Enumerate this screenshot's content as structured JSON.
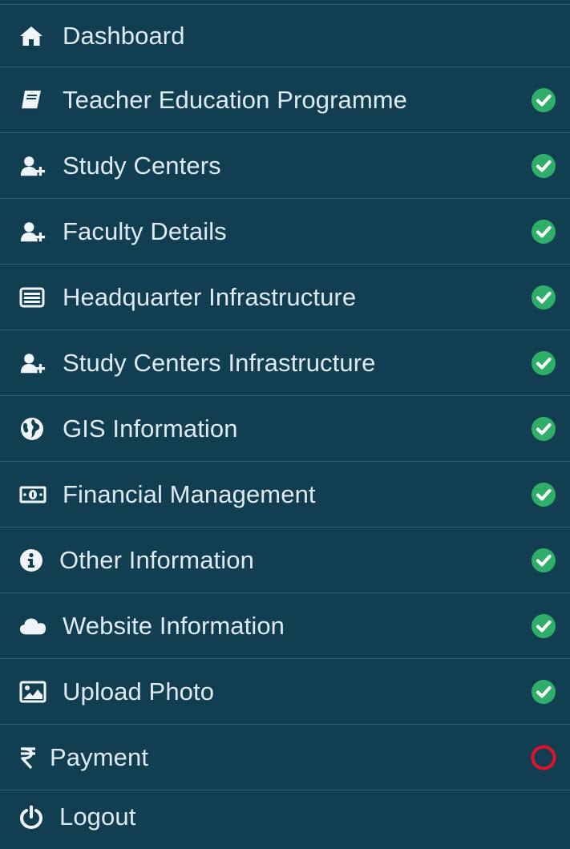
{
  "sidebar": {
    "items": [
      {
        "label": "Dashboard",
        "icon": "home-icon",
        "status": "none"
      },
      {
        "label": "Teacher Education Programme",
        "icon": "book-icon",
        "status": "complete"
      },
      {
        "label": "Study Centers",
        "icon": "user-plus-icon",
        "status": "complete"
      },
      {
        "label": "Faculty Details",
        "icon": "user-plus-icon",
        "status": "complete"
      },
      {
        "label": "Headquarter Infrastructure",
        "icon": "list-alt-icon",
        "status": "complete"
      },
      {
        "label": "Study Centers Infrastructure",
        "icon": "user-plus-icon",
        "status": "complete"
      },
      {
        "label": "GIS Information",
        "icon": "globe-icon",
        "status": "complete"
      },
      {
        "label": "Financial Management",
        "icon": "money-icon",
        "status": "complete"
      },
      {
        "label": "Other Information",
        "icon": "info-icon",
        "status": "complete"
      },
      {
        "label": "Website Information",
        "icon": "cloud-icon",
        "status": "complete"
      },
      {
        "label": "Upload Photo",
        "icon": "image-icon",
        "status": "complete"
      },
      {
        "label": "Payment",
        "icon": "rupee-icon",
        "status": "pending"
      },
      {
        "label": "Logout",
        "icon": "power-icon",
        "status": "none"
      }
    ]
  },
  "colors": {
    "background": "#113e51",
    "divider": "#2b6479",
    "text": "#dfeaf0",
    "complete": "#2fae6a",
    "pending": "#e0122c"
  }
}
